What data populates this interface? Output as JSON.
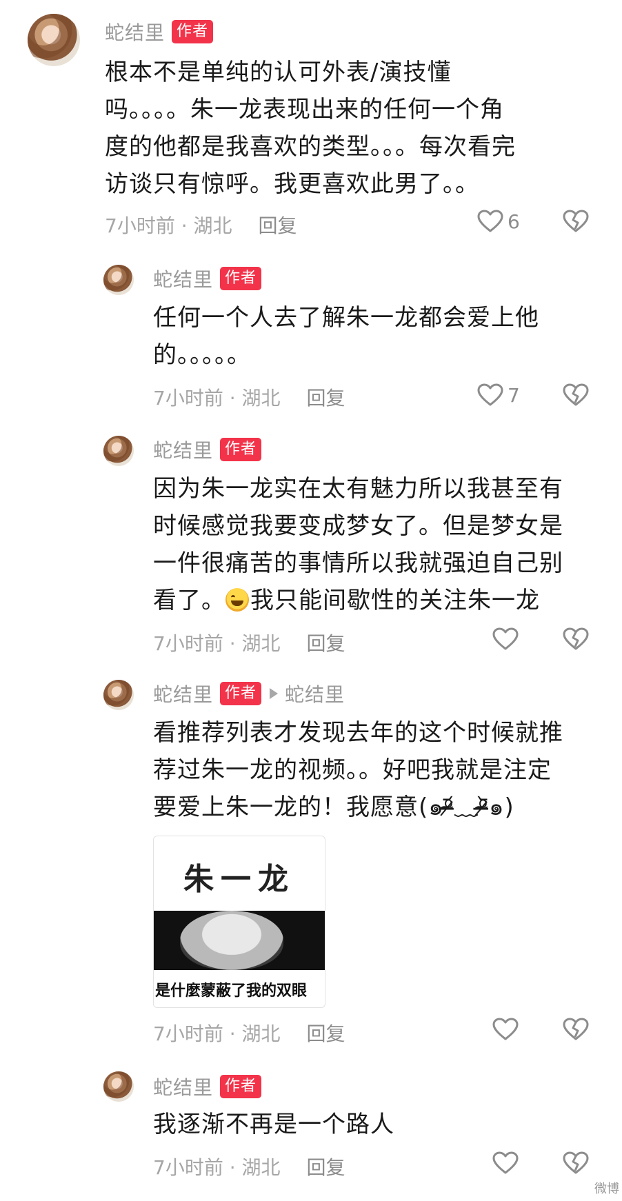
{
  "comments": [
    {
      "name": "蛇结里",
      "badge": "作者",
      "lines": [
        "根本不是单纯的认可外表/演技懂",
        "吗。。。。朱一龙表现出来的任何一个角",
        "度的他都是我喜欢的类型。。。每次看完",
        "访谈只有惊呼。我更喜欢此男了。。"
      ],
      "time_location": "7小时前 · 湖北",
      "reply_label": "回复",
      "like_count": "6"
    },
    {
      "name": "蛇结里",
      "badge": "作者",
      "lines": [
        "任何一个人去了解朱一龙都会爱上他",
        "的。。。。。"
      ],
      "time_location": "7小时前 · 湖北",
      "reply_label": "回复",
      "like_count": "7"
    },
    {
      "name": "蛇结里",
      "badge": "作者",
      "lines": [
        "因为朱一龙实在太有魅力所以我甚至有",
        "时候感觉我要变成梦女了。但是梦女是",
        "一件很痛苦的事情所以我就强迫自己别"
      ],
      "last_line_prefix": "看了。",
      "last_line_suffix": "我只能间歇性的关注朱一龙",
      "time_location": "7小时前 · 湖北",
      "reply_label": "回复",
      "like_count": ""
    },
    {
      "name": "蛇结里",
      "badge": "作者",
      "reply_to": "蛇结里",
      "lines": [
        "看推荐列表才发现去年的这个时候就推",
        "荐过朱一龙的视频。。好吧我就是注定",
        "要爱上朱一龙的！我愿意(๑ᵒ̴̶̷᷄﹏ᵒ̴̶̷᷅๑)"
      ],
      "meme": {
        "title": "朱一龙",
        "caption": "是什麼蒙蔽了我的双眼"
      },
      "time_location": "7小时前 · 湖北",
      "reply_label": "回复",
      "like_count": ""
    },
    {
      "name": "蛇结里",
      "badge": "作者",
      "lines": [
        "我逐渐不再是一个路人"
      ],
      "time_location": "7小时前 · 湖北",
      "reply_label": "回复",
      "like_count": ""
    }
  ],
  "watermark": "微博",
  "icons": {
    "like": "heart-outline-icon",
    "dislike": "broken-heart-icon"
  },
  "colors": {
    "badge": "#f2334a",
    "name": "#9a9a9a",
    "meta": "#a6a6a6",
    "icon": "#8c8c8c"
  }
}
